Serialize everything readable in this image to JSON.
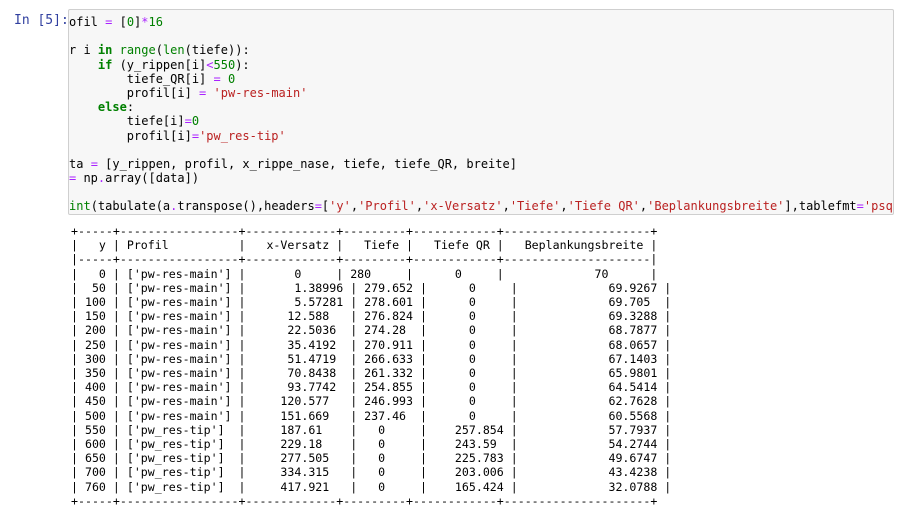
{
  "prompt": "In [5]:",
  "code_lines": [
    [
      {
        "t": "ofil ",
        "c": ""
      },
      {
        "t": "=",
        "c": "op"
      },
      {
        "t": " [",
        "c": ""
      },
      {
        "t": "0",
        "c": "num"
      },
      {
        "t": "]",
        "c": ""
      },
      {
        "t": "*",
        "c": "op"
      },
      {
        "t": "16",
        "c": "num"
      }
    ],
    [],
    [
      {
        "t": "r i ",
        "c": ""
      },
      {
        "t": "in",
        "c": "kw"
      },
      {
        "t": " ",
        "c": ""
      },
      {
        "t": "range",
        "c": "bi"
      },
      {
        "t": "(",
        "c": ""
      },
      {
        "t": "len",
        "c": "bi"
      },
      {
        "t": "(tiefe)):",
        "c": ""
      }
    ],
    [
      {
        "t": "    ",
        "c": ""
      },
      {
        "t": "if",
        "c": "kw"
      },
      {
        "t": " (y_rippen[i]",
        "c": ""
      },
      {
        "t": "<",
        "c": "op"
      },
      {
        "t": "550",
        "c": "num"
      },
      {
        "t": "):",
        "c": ""
      }
    ],
    [
      {
        "t": "        tiefe_QR[i] ",
        "c": ""
      },
      {
        "t": "=",
        "c": "op"
      },
      {
        "t": " ",
        "c": ""
      },
      {
        "t": "0",
        "c": "num"
      }
    ],
    [
      {
        "t": "        profil[i] ",
        "c": ""
      },
      {
        "t": "=",
        "c": "op"
      },
      {
        "t": " ",
        "c": ""
      },
      {
        "t": "'pw-res-main'",
        "c": "str"
      }
    ],
    [
      {
        "t": "    ",
        "c": ""
      },
      {
        "t": "else",
        "c": "kw"
      },
      {
        "t": ":",
        "c": ""
      }
    ],
    [
      {
        "t": "        tiefe[i]",
        "c": ""
      },
      {
        "t": "=",
        "c": "op"
      },
      {
        "t": "0",
        "c": "num"
      }
    ],
    [
      {
        "t": "        profil[i]",
        "c": ""
      },
      {
        "t": "=",
        "c": "op"
      },
      {
        "t": "'pw_res-tip'",
        "c": "str"
      }
    ],
    [],
    [
      {
        "t": "ta ",
        "c": ""
      },
      {
        "t": "=",
        "c": "op"
      },
      {
        "t": " [y_rippen, profil, x_rippe_nase, tiefe, tiefe_QR, breite]",
        "c": ""
      }
    ],
    [
      {
        "t": "= ",
        "c": "op"
      },
      {
        "t": "np",
        "c": ""
      },
      {
        "t": ".",
        "c": "op"
      },
      {
        "t": "array([data])",
        "c": ""
      }
    ],
    [],
    [
      {
        "t": "int",
        "c": "bi"
      },
      {
        "t": "(tabulate(a",
        "c": ""
      },
      {
        "t": ".",
        "c": "op"
      },
      {
        "t": "transpose(),headers",
        "c": ""
      },
      {
        "t": "=",
        "c": "op"
      },
      {
        "t": "[",
        "c": ""
      },
      {
        "t": "'y'",
        "c": "str"
      },
      {
        "t": ",",
        "c": ""
      },
      {
        "t": "'Profil'",
        "c": "str"
      },
      {
        "t": ",",
        "c": ""
      },
      {
        "t": "'x-Versatz'",
        "c": "str"
      },
      {
        "t": ",",
        "c": ""
      },
      {
        "t": "'Tiefe'",
        "c": "str"
      },
      {
        "t": ",",
        "c": ""
      },
      {
        "t": "'Tiefe QR'",
        "c": "str"
      },
      {
        "t": ",",
        "c": ""
      },
      {
        "t": "'Beplankungsbreite'",
        "c": "str"
      },
      {
        "t": "],tablefmt",
        "c": ""
      },
      {
        "t": "=",
        "c": "op"
      },
      {
        "t": "'psql'",
        "c": "str"
      },
      {
        "t": "))",
        "c": ""
      }
    ]
  ],
  "output_lines": [
    "+-----+-----------------+-------------+---------+------------+---------------------+",
    "|   y | Profil          |   x-Versatz |   Tiefe |   Tiefe QR |   Beplankungsbreite |",
    "|-----+-----------------+-------------+---------+------------+---------------------|",
    "|   0 | ['pw-res-main'] |       0     | 280     |      0     |             70      |",
    "|  50 | ['pw-res-main'] |       1.38996 | 279.652 |      0     |             69.9267 |",
    "| 100 | ['pw-res-main'] |       5.57281 | 278.601 |      0     |             69.705  |",
    "| 150 | ['pw-res-main'] |      12.588   | 276.824 |      0     |             69.3288 |",
    "| 200 | ['pw-res-main'] |      22.5036  | 274.28  |      0     |             68.7877 |",
    "| 250 | ['pw-res-main'] |      35.4192  | 270.911 |      0     |             68.0657 |",
    "| 300 | ['pw-res-main'] |      51.4719  | 266.633 |      0     |             67.1403 |",
    "| 350 | ['pw-res-main'] |      70.8438  | 261.332 |      0     |             65.9801 |",
    "| 400 | ['pw-res-main'] |      93.7742  | 254.855 |      0     |             64.5414 |",
    "| 450 | ['pw-res-main'] |     120.577   | 246.993 |      0     |             62.7628 |",
    "| 500 | ['pw-res-main'] |     151.669   | 237.46  |      0     |             60.5568 |",
    "| 550 | ['pw_res-tip']  |     187.61    |   0     |    257.854 |             57.7937 |",
    "| 600 | ['pw_res-tip']  |     229.18    |   0     |    243.59  |             54.2744 |",
    "| 650 | ['pw_res-tip']  |     277.505   |   0     |    225.783 |             49.6747 |",
    "| 700 | ['pw_res-tip']  |     334.315   |   0     |    203.006 |             43.4238 |",
    "| 760 | ['pw_res-tip']  |     417.921   |   0     |    165.424 |             32.0788 |",
    "+-----+-----------------+-------------+---------+------------+---------------------+"
  ]
}
